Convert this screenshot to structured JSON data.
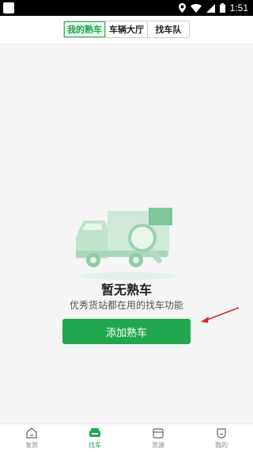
{
  "status_bar": {
    "time": "1:51",
    "icons": [
      "location-icon",
      "wifi-icon",
      "signal-icon",
      "battery-icon"
    ]
  },
  "header": {
    "tabs": [
      {
        "label": "我的熟车",
        "active": true
      },
      {
        "label": "车辆大厅",
        "active": false
      },
      {
        "label": "找车队",
        "active": false
      }
    ]
  },
  "empty_state": {
    "icon": "truck-magnifier-illustration",
    "title": "暂无熟车",
    "subtitle": "优秀货站都在用的找车功能",
    "button_label": "添加熟车"
  },
  "bottom_nav": {
    "items": [
      {
        "label": "发货",
        "icon": "home-icon",
        "active": false
      },
      {
        "label": "找车",
        "icon": "car-icon",
        "active": true
      },
      {
        "label": "货源",
        "icon": "box-icon",
        "active": false
      },
      {
        "label": "我的",
        "icon": "profile-icon",
        "active": false
      }
    ]
  },
  "colors": {
    "accent": "#21a74f",
    "accent_light": "#e9f7ee",
    "annotation_arrow": "#d62828"
  }
}
